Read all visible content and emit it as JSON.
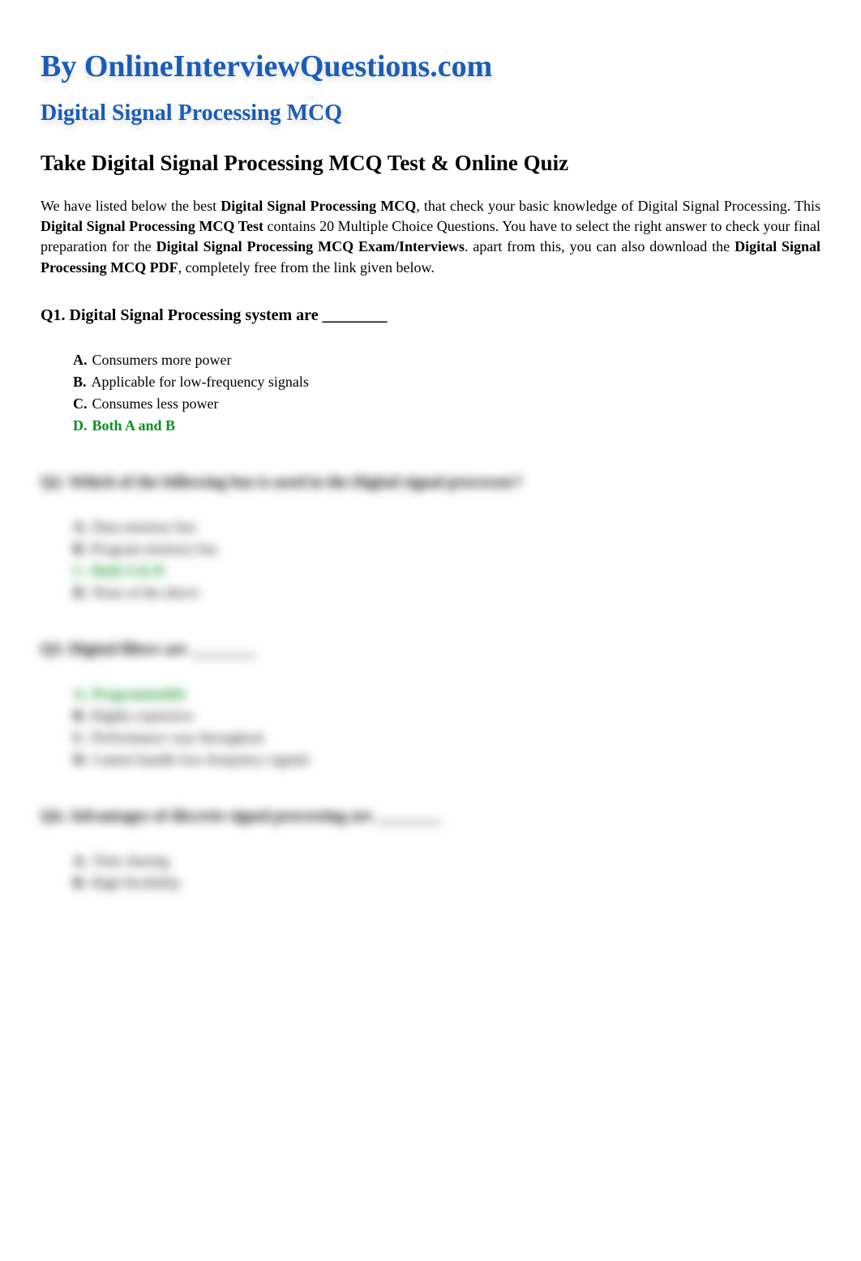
{
  "header": {
    "main_title": "By OnlineInterviewQuestions.com",
    "sub_title": "Digital Signal Processing MCQ",
    "section_heading": "Take Digital Signal Processing MCQ Test & Online Quiz"
  },
  "intro": {
    "part1": "We have listed below the best ",
    "bold1": "Digital Signal Processing MCQ",
    "part2": ", that check your basic knowledge of Digital Signal Processing. This ",
    "bold2": "Digital Signal Processing MCQ Test",
    "part3": " contains 20 Multiple Choice Questions. You have to select the right answer to check your final preparation for the ",
    "bold3": "Digital Signal Processing MCQ Exam/Interviews",
    "part4": ". apart from this, you can also download the ",
    "bold4": "Digital Signal Processing MCQ PDF",
    "part5": ", completely free from the link given below."
  },
  "questions": [
    {
      "q": "Q1. Digital Signal Processing system are ________",
      "answers": [
        {
          "letter": "A.",
          "text": "Consumers more power",
          "correct": false
        },
        {
          "letter": "B.",
          "text": "Applicable for low-frequency signals",
          "correct": false
        },
        {
          "letter": "C.",
          "text": "Consumes less power",
          "correct": false
        },
        {
          "letter": "D.",
          "text": "Both A and B",
          "correct": true
        }
      ],
      "blurred": false
    },
    {
      "q": "Q2. Which of the following bus is used in the Digital signal processor?",
      "answers": [
        {
          "letter": "A.",
          "text": "Data memory bus",
          "correct": false
        },
        {
          "letter": "B.",
          "text": "Program memory bus",
          "correct": false
        },
        {
          "letter": "C.",
          "text": "Both A & B",
          "correct": true
        },
        {
          "letter": "D.",
          "text": "None of the above",
          "correct": false
        }
      ],
      "blurred": true
    },
    {
      "q": "Q3. Digital filters are ________",
      "answers": [
        {
          "letter": "A.",
          "text": "Programmable",
          "correct": true
        },
        {
          "letter": "B.",
          "text": "Highly expensive",
          "correct": false
        },
        {
          "letter": "C.",
          "text": "Performance vary throughout",
          "correct": false
        },
        {
          "letter": "D.",
          "text": "Cannot handle low-frequency signals",
          "correct": false
        }
      ],
      "blurred": true
    },
    {
      "q": "Q4. Advantages of discrete signal processing are ________",
      "answers": [
        {
          "letter": "A.",
          "text": "Time sharing",
          "correct": false
        },
        {
          "letter": "B.",
          "text": "High flexibility",
          "correct": false
        }
      ],
      "blurred": true
    }
  ]
}
